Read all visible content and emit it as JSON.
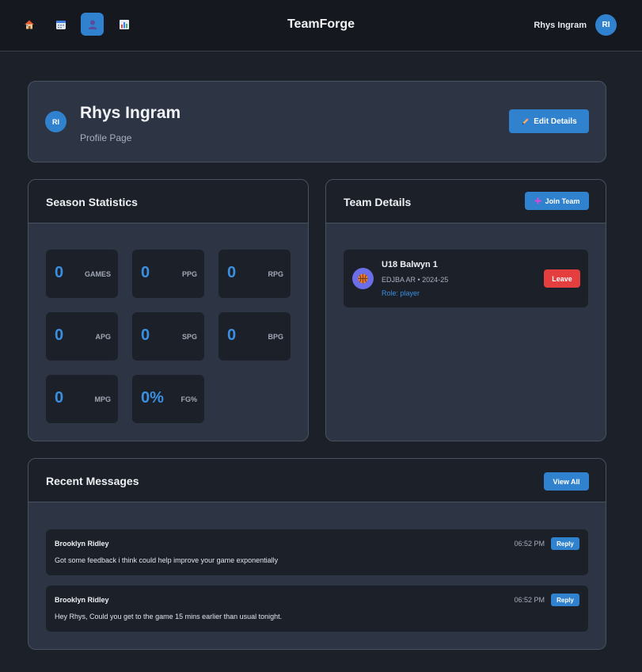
{
  "app": {
    "title": "TeamForge",
    "nav": [
      {
        "icon": "home-icon"
      },
      {
        "icon": "calendar-icon"
      },
      {
        "icon": "profile-icon",
        "active": true
      },
      {
        "icon": "stats-icon"
      }
    ],
    "user": {
      "name": "Rhys Ingram",
      "initials": "RI"
    }
  },
  "profile": {
    "initials": "RI",
    "name": "Rhys Ingram",
    "subtitle": "Profile Page",
    "edit_label": "Edit Details"
  },
  "stats": {
    "title": "Season Statistics",
    "items": [
      {
        "value": "0",
        "label": "GAMES"
      },
      {
        "value": "0",
        "label": "PPG"
      },
      {
        "value": "0",
        "label": "RPG"
      },
      {
        "value": "0",
        "label": "APG"
      },
      {
        "value": "0",
        "label": "SPG"
      },
      {
        "value": "0",
        "label": "BPG"
      },
      {
        "value": "0",
        "label": "MPG"
      },
      {
        "value": "0%",
        "label": "FG%"
      }
    ]
  },
  "team": {
    "title": "Team Details",
    "join_label": "Join Team",
    "teams": [
      {
        "name": "U18 Balwyn 1",
        "meta": "EDJBA AR • 2024-25",
        "role": "Role: player",
        "leave_label": "Leave"
      }
    ]
  },
  "messages": {
    "title": "Recent Messages",
    "view_all_label": "View All",
    "items": [
      {
        "author": "Brooklyn Ridley",
        "time": "06:52 PM",
        "text": "Got some feedback i think could help improve your game exponentially",
        "reply_label": "Reply"
      },
      {
        "author": "Brooklyn Ridley",
        "time": "06:52 PM",
        "text": "Hey Rhys, Could you get to the game 15 mins earlier than usual tonight.",
        "reply_label": "Reply"
      }
    ]
  },
  "colors": {
    "accent": "#3182ce",
    "danger": "#e53e3e",
    "background": "#1c2029",
    "card": "#2d3544"
  }
}
